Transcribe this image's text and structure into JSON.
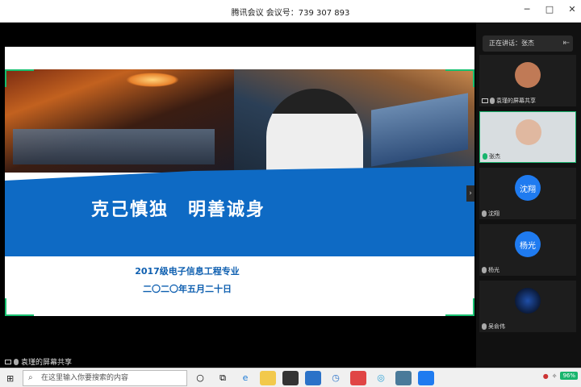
{
  "window": {
    "title": "腾讯会议 会议号：739 307 893",
    "controls": [
      "─",
      "□",
      "✕"
    ]
  },
  "slide": {
    "heading": "克己慎独　明善诚身",
    "subtitle": "2017级电子信息工程专业",
    "date": "二〇二〇年五月二十日"
  },
  "sharing": {
    "label": "袁瑾的屏幕共享"
  },
  "panel": {
    "speaking_label": "正在讲话：张杰",
    "participants": [
      {
        "name": "袁瑾的屏幕共享",
        "avatar_text": "",
        "avatar_color": "#c07a56",
        "mic": "off"
      },
      {
        "name": "张杰",
        "avatar_text": "",
        "avatar_color": "#e0b8a0",
        "mic": "on",
        "active": true
      },
      {
        "name": "沈翔",
        "avatar_text": "沈翔",
        "avatar_color": "#1f7bf0",
        "mic": "off"
      },
      {
        "name": "杨光",
        "avatar_text": "杨光",
        "avatar_color": "#1f7bf0",
        "mic": "off"
      },
      {
        "name": "吴俞伟",
        "avatar_text": "",
        "avatar_color": "#0b1a3a",
        "mic": "off"
      }
    ]
  },
  "taskbar": {
    "search_placeholder": "在这里输入你要搜索的内容",
    "battery": "96%"
  }
}
